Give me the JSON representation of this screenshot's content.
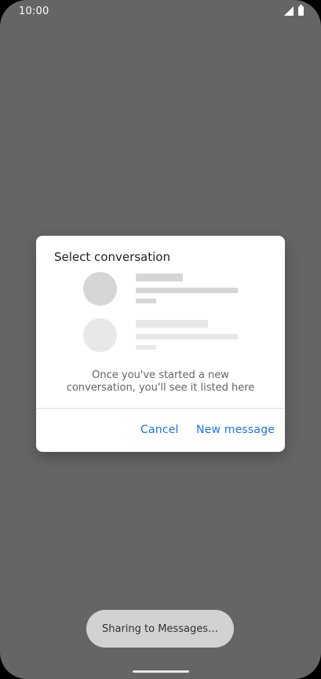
{
  "status_bar": {
    "time": "10:00",
    "icons": [
      "cell-signal-icon",
      "battery-icon"
    ]
  },
  "dialog": {
    "title": "Select conversation",
    "empty_message": "Once you've started a new conversation, you'll see it listed here",
    "buttons": {
      "cancel": "Cancel",
      "new_message": "New message"
    },
    "skeleton_color_dark": "#d6d6d6",
    "skeleton_color_light": "#e8e8e8"
  },
  "toast": {
    "text": "Sharing to Messages…"
  },
  "colors": {
    "scrim": "#656565",
    "accent": "#1a73e8",
    "dialog_bg": "#ffffff",
    "toast_bg": "#d2d2d2"
  }
}
